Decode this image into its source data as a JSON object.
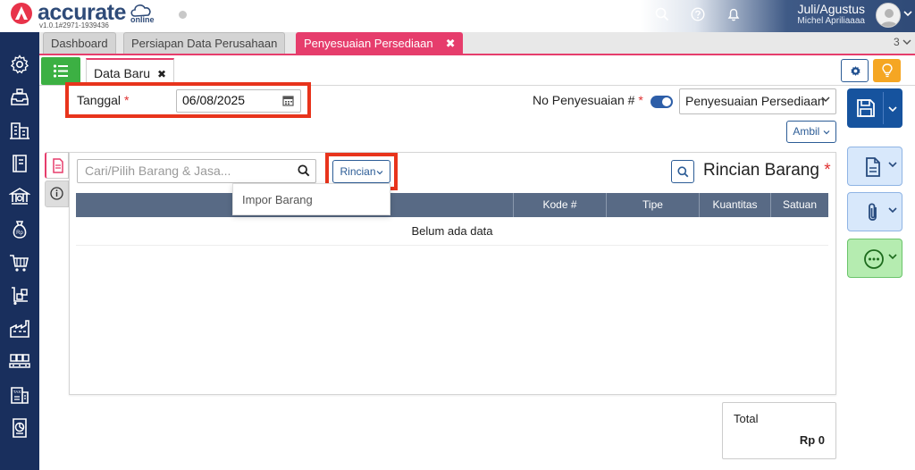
{
  "header": {
    "brand": "accurate",
    "brand_sub": "online",
    "version": "v1.0.1#2971-1939436",
    "period": "Juli/Agustus",
    "user": "Michel Apriliaaaa"
  },
  "tabs": [
    {
      "label": "Dashboard"
    },
    {
      "label": "Persiapan Data Perusahaan"
    },
    {
      "label": "Penyesuaian Persediaan",
      "close": "✖"
    }
  ],
  "tab_count": "3",
  "subtab": {
    "label": "Data Baru",
    "close": "✖"
  },
  "form": {
    "tanggal_label": "Tanggal",
    "required_mark": "*",
    "tanggal_value": "06/08/2025",
    "no_label": "No Penyesuaian #",
    "no_select_value": "Penyesuaian Persediaan",
    "ambil_label": "Ambil"
  },
  "detail": {
    "search_placeholder": "Cari/Pilih Barang & Jasa...",
    "rincian_button": "Rincian",
    "dropdown_item": "Impor Barang",
    "title": "Rincian Barang",
    "columns": [
      "Kode #",
      "Tipe",
      "Kuantitas",
      "Satuan"
    ],
    "empty_text": "Belum ada data"
  },
  "total": {
    "label": "Total",
    "value": "Rp 0"
  },
  "colors": {
    "accent_pink": "#e63d6c",
    "navy": "#192f5d",
    "highlight_red": "#e8341c",
    "primary_blue": "#16539e",
    "green": "#3cb043"
  }
}
